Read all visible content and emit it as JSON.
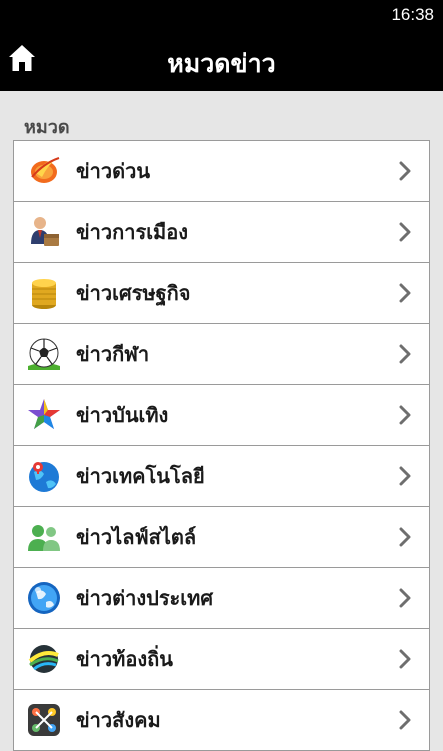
{
  "status_bar": {
    "time": "16:38"
  },
  "header": {
    "title": "หมวดข่าว",
    "home_icon": "home-icon"
  },
  "section": {
    "label": "หมวด"
  },
  "categories": [
    {
      "label": "ข่าวด่วน",
      "icon": "breaking-news-icon"
    },
    {
      "label": "ข่าวการเมือง",
      "icon": "politics-icon"
    },
    {
      "label": "ข่าวเศรษฐกิจ",
      "icon": "economy-coins-icon"
    },
    {
      "label": "ข่าวกีฬา",
      "icon": "sports-ball-icon"
    },
    {
      "label": "ข่าวบันเทิง",
      "icon": "entertainment-star-icon"
    },
    {
      "label": "ข่าวเทคโนโลยี",
      "icon": "technology-globe-icon"
    },
    {
      "label": "ข่าวไลฟ์สไตล์",
      "icon": "lifestyle-people-icon"
    },
    {
      "label": "ข่าวต่างประเทศ",
      "icon": "world-globe-icon"
    },
    {
      "label": "ข่าวท้องถิ่น",
      "icon": "local-news-icon"
    },
    {
      "label": "ข่าวสังคม",
      "icon": "social-icon"
    }
  ],
  "colors": {
    "header_bg": "#000000",
    "list_bg": "#ffffff",
    "page_bg": "#e6e6e6",
    "divider": "#9a9a9a"
  }
}
